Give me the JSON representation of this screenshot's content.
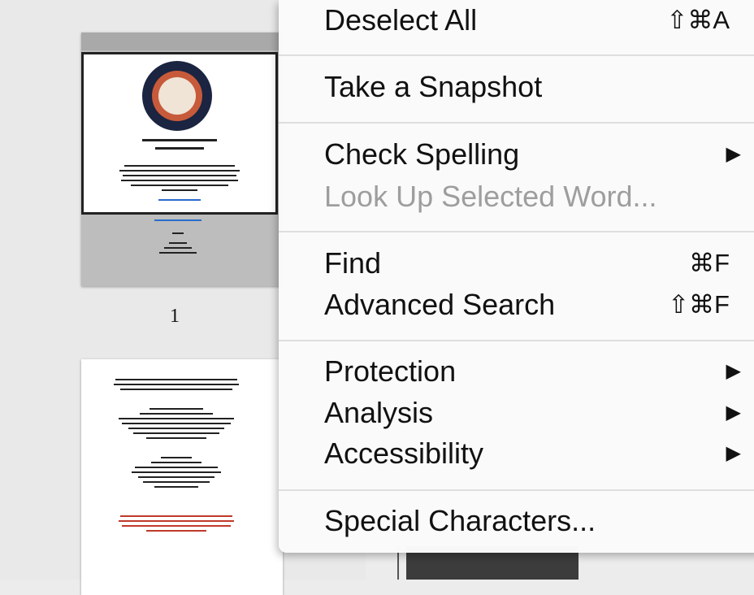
{
  "sidebar": {
    "page_label": "1"
  },
  "menu": {
    "items": [
      {
        "label": "Deselect All",
        "shortcut": "⇧⌘A",
        "enabled": true
      },
      {
        "label": "Take a Snapshot",
        "shortcut": "",
        "enabled": true
      },
      {
        "label": "Check Spelling",
        "submenu_icon": "▶",
        "enabled": true
      },
      {
        "label": "Look Up Selected Word...",
        "enabled": false
      },
      {
        "label": "Find",
        "shortcut": "⌘F",
        "enabled": true
      },
      {
        "label": "Advanced Search",
        "shortcut": "⇧⌘F",
        "enabled": true
      },
      {
        "label": "Protection",
        "submenu_icon": "▶",
        "enabled": true
      },
      {
        "label": "Analysis",
        "submenu_icon": "▶",
        "enabled": true
      },
      {
        "label": "Accessibility",
        "submenu_icon": "▶",
        "enabled": true
      },
      {
        "label": "Special Characters...",
        "enabled": true
      }
    ]
  }
}
